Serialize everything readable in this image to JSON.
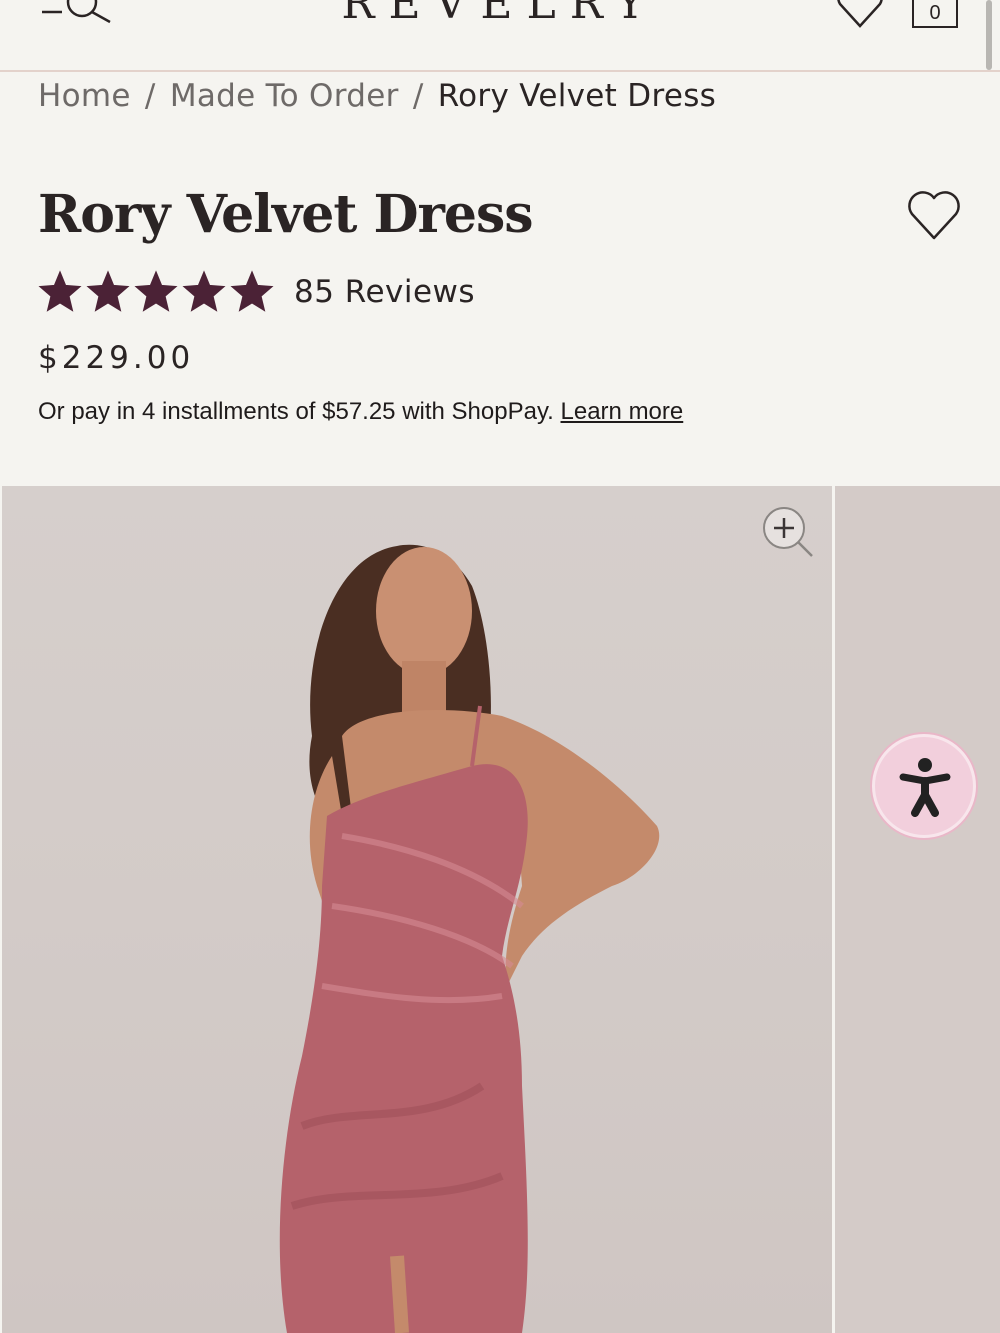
{
  "header": {
    "logo": "REVELRY",
    "cart_count": "0"
  },
  "breadcrumb": {
    "items": [
      "Home",
      "Made To Order"
    ],
    "separator": "/",
    "current": "Rory Velvet Dress"
  },
  "product": {
    "title": "Rory Velvet Dress",
    "rating_stars": 5,
    "reviews": "85 Reviews",
    "price": "$229.00",
    "installments_text": "Or pay in 4 installments of $57.25 with ShopPay.",
    "learn_more": "Learn more"
  },
  "colors": {
    "accent": "#4b2236",
    "background": "#f5f4f0",
    "dress": "#b5626b",
    "a11y_button": "#f2cfdc"
  },
  "icons": {
    "menu": "menu-search-icon",
    "wishlist": "heart-icon",
    "cart": "bag-icon",
    "zoom": "zoom-in-icon",
    "accessibility": "accessibility-icon"
  }
}
